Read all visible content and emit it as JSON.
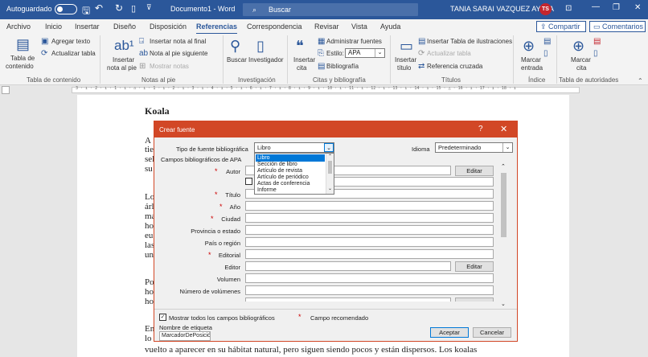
{
  "titlebar": {
    "autosave": "Autoguardado",
    "doc_title": "Documento1  -  Word",
    "search": "Buscar",
    "user": "TANIA SARAI VAZQUEZ AYALA",
    "initials": "TS"
  },
  "tabs": [
    "Archivo",
    "Inicio",
    "Insertar",
    "Diseño",
    "Disposición",
    "Referencias",
    "Correspondencia",
    "Revisar",
    "Vista",
    "Ayuda"
  ],
  "share": "Compartir",
  "comments": "Comentarios",
  "ribbon": {
    "toc": {
      "l1": "Tabla de",
      "l2": "contenido",
      "add_text": "Agregar texto",
      "update": "Actualizar tabla",
      "group": "Tabla de contenido"
    },
    "footnotes": {
      "insert1": "Insertar",
      "insert2": "nota al pie",
      "insert_end": "Insertar nota al final",
      "next": "Nota al pie siguiente",
      "show": "Mostrar notas",
      "group": "Notas al pie"
    },
    "research": {
      "search": "Buscar",
      "researcher": "Investigador",
      "group": "Investigación"
    },
    "citations": {
      "insert1": "Insertar",
      "insert2": "cita",
      "manage": "Administrar fuentes",
      "style_label": "Estilo:",
      "style_value": "APA",
      "bibliography": "Bibliografía",
      "group": "Citas y bibliografía"
    },
    "captions": {
      "insert1": "Insertar",
      "insert2": "título",
      "insert_table": "Insertar Tabla de ilustraciones",
      "update": "Actualizar tabla",
      "cross": "Referencia cruzada",
      "group": "Títulos"
    },
    "index": {
      "mark1": "Marcar",
      "mark2": "entrada",
      "group": "Índice"
    },
    "authorities": {
      "mark1": "Marcar",
      "mark2": "cita",
      "group": "Tabla de autoridades"
    }
  },
  "ruler": "3 · ı · 2 · ı · 1 · ı · ⌂ · ı · 1 · ı · 2 · ı · 3 · ı · 4 · ı · 5 · ı · 6 · ı · 7 · ı · 8 · ı · 9 · ı · 10 · ı · 11 · ı · 12 · ı · 13 · ı · 14 · ı · 15 · △ · 16 · ı · 17 · ı · 18 · ı",
  "document": {
    "heading": "Koala",
    "left_fragments": [
      "A",
      "tie",
      "sel",
      "su",
      "Lo",
      "árl",
      "ma",
      "ho",
      "eu",
      "las",
      "un",
      "Po",
      "ho",
      "ho",
      "En",
      "lo"
    ],
    "last_line": "vuelto a aparecer en su hábitat natural, pero siguen siendo pocos y están dispersos. Los koalas"
  },
  "dialog": {
    "title": "Crear fuente",
    "help": "?",
    "close": "✕",
    "source_type_label": "Tipo de fuente bibliográfica",
    "source_type_value": "Libro",
    "language_label": "Idioma",
    "language_value": "Predeterminado",
    "apa_fields_label": "Campos bibliográficos de APA",
    "dropdown_options": [
      "Libro",
      "Sección de libro",
      "Artículo de revista",
      "Artículo de periódico",
      "Actas de conferencia",
      "Informe"
    ],
    "fields": [
      {
        "label": "Autor",
        "required": true,
        "edit": true
      },
      {
        "label": "Título",
        "required": true,
        "edit": false
      },
      {
        "label": "Año",
        "required": true,
        "edit": false
      },
      {
        "label": "Ciudad",
        "required": true,
        "edit": false
      },
      {
        "label": "Provincia o estado",
        "required": false,
        "edit": false
      },
      {
        "label": "País o región",
        "required": false,
        "edit": false
      },
      {
        "label": "Editorial",
        "required": true,
        "edit": false
      },
      {
        "label": "Editor",
        "required": false,
        "edit": true
      },
      {
        "label": "Volumen",
        "required": false,
        "edit": false
      },
      {
        "label": "Número de volúmenes",
        "required": false,
        "edit": false
      }
    ],
    "edit_label": "Editar",
    "show_all_label": "Mostrar todos los campos bibliográficos",
    "recommended_label": "Campo recomendado",
    "tag_label": "Nombre de etiqueta",
    "tag_value": "MarcadorDePosición1",
    "accept": "Aceptar",
    "cancel": "Cancelar"
  }
}
